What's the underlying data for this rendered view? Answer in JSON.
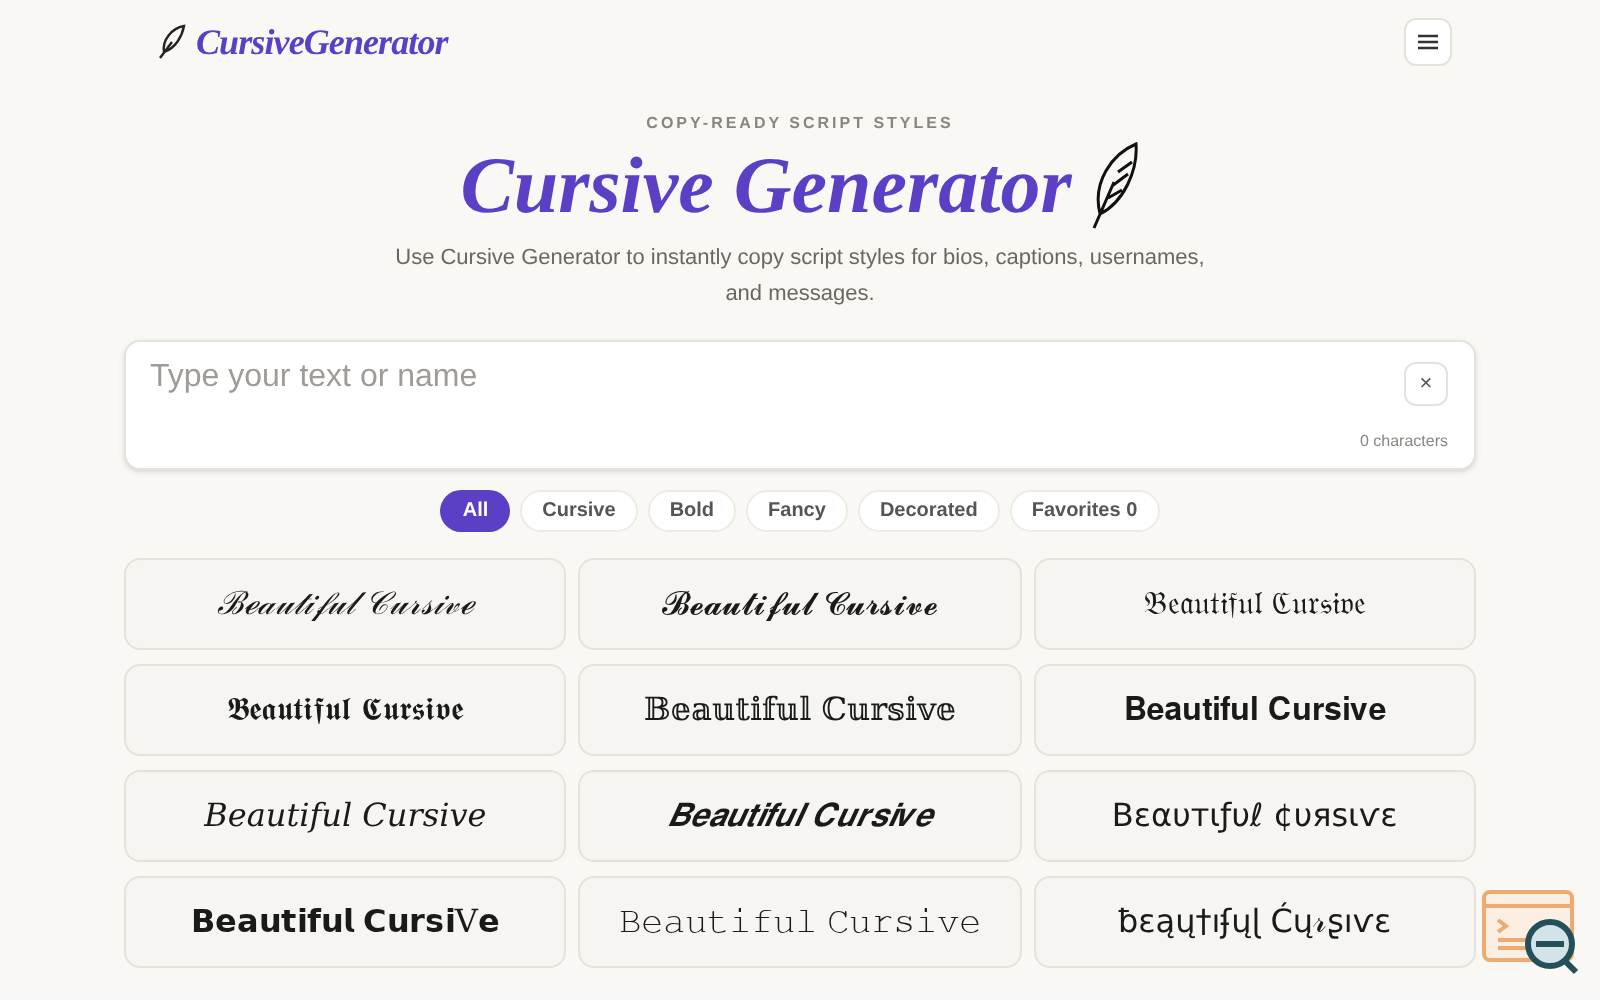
{
  "header": {
    "logo": "CursiveGenerator"
  },
  "hero": {
    "eyebrow": "COPY-READY SCRIPT STYLES",
    "title": "Cursive Generator",
    "description": "Use Cursive Generator to instantly copy script styles for bios, captions, usernames, and messages."
  },
  "input": {
    "placeholder": "Type your text or name",
    "clear": "×",
    "count": "0 characters"
  },
  "filters": [
    {
      "label": "All",
      "selected": true
    },
    {
      "label": "Cursive",
      "selected": false
    },
    {
      "label": "Bold",
      "selected": false
    },
    {
      "label": "Fancy",
      "selected": false
    },
    {
      "label": "Decorated",
      "selected": false
    },
    {
      "label": "Favorites 0",
      "selected": false
    }
  ],
  "styles": [
    {
      "text": "ℬℯ𝒶𝓊𝓉𝒾𝒻𝓊𝓁 𝒞𝓊𝓇𝓈𝒾𝓋ℯ",
      "kind": "italic"
    },
    {
      "text": "𝓑𝓮𝓪𝓾𝓽𝓲𝓯𝓾𝓵 𝓒𝓾𝓻𝓼𝓲𝓿𝓮",
      "kind": "plain"
    },
    {
      "text": "𝔅𝔢𝔞𝔲𝔱𝔦𝔣𝔲𝔩 ℭ𝔲𝔯𝔰𝔦𝔳𝔢",
      "kind": "plain"
    },
    {
      "text": "𝕭𝖊𝖆𝖚𝖙𝖎𝖋𝖚𝖑 𝕮𝖚𝖗𝖘𝖎𝖛𝖊",
      "kind": "plain"
    },
    {
      "text": "𝔹𝕖𝕒𝕦𝕥𝕚𝕗𝕦𝕝 ℂ𝕦𝕣𝕤𝕚𝕧𝕖",
      "kind": "plain"
    },
    {
      "text": "𝐁𝐞𝐚𝐮𝐭𝐢𝐟𝐮𝐥 𝐂𝐮𝐫𝐬𝐢𝐯𝐞",
      "kind": "plain"
    },
    {
      "text": "𝐵𝑒𝑎𝑢𝑡𝑖𝑓𝑢𝑙 𝐶𝑢𝑟𝑠𝑖𝑣𝑒",
      "kind": "plain"
    },
    {
      "text": "𝑩𝒆𝒂𝒖𝒕𝒊𝒇𝒖𝒍 𝑪𝒖𝒓𝒔𝒊𝒗𝒆",
      "kind": "italic"
    },
    {
      "text": "Bɛαυтιƒυℓ ¢υяѕιѵɛ",
      "kind": "sans"
    },
    {
      "text": "𝗕𝗲𝗮𝘂𝘁𝗶𝗳𝘂𝗹 𝗖𝘂𝗿𝘀𝗶V𝗲",
      "kind": "plain"
    },
    {
      "text": "𝙱𝚎𝚊𝚞𝚝𝚒𝚏𝚞𝚕 𝙲𝚞𝚛𝚜𝚒𝚟𝚎",
      "kind": "plain"
    },
    {
      "text": "ƀɛąų†ıʄųɭ Ćų𝓇ʂıѵɛ",
      "kind": "sans"
    }
  ]
}
